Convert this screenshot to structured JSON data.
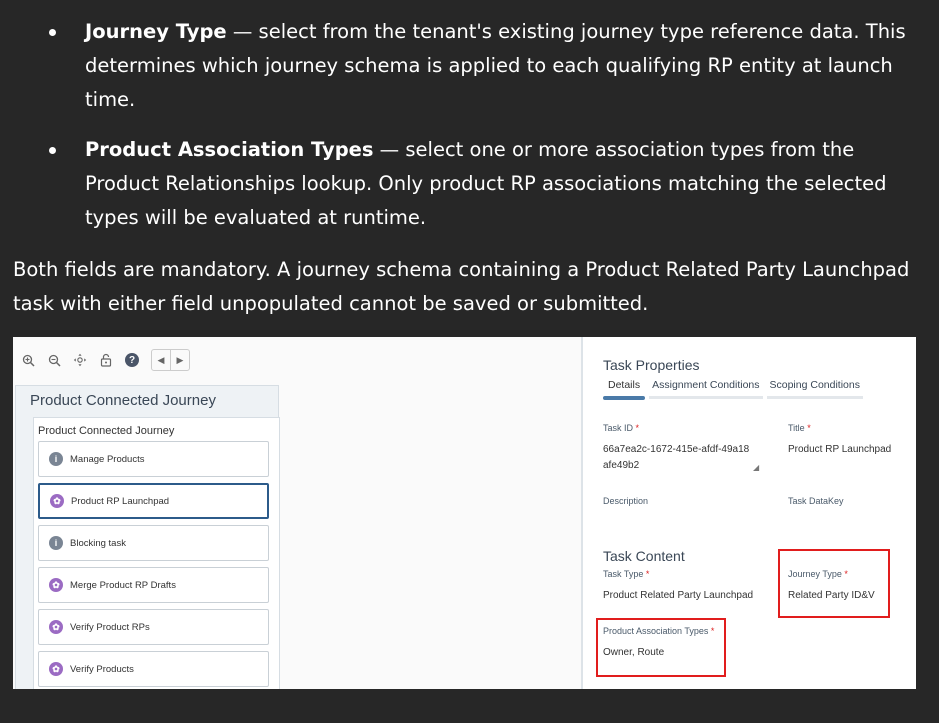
{
  "bullets": [
    {
      "term": "Journey Type",
      "text": " — select from the tenant's existing journey type reference data. This determines which journey schema is applied to each qualifying RP entity at launch time."
    },
    {
      "term": "Product Association Types",
      "text": " — select one or more association types from the Product Relationships lookup. Only product RP associations matching the selected types will be evaluated at runtime."
    }
  ],
  "paragraph": "Both fields are mandatory. A journey schema containing a Product Related Party Launchpad task with either field unpopulated cannot be saved or submitted.",
  "screenshot": {
    "toolbar": {
      "icons": [
        "zoom-in-icon",
        "zoom-out-icon",
        "move-icon",
        "lock-icon",
        "help-icon"
      ],
      "help_glyph": "?",
      "nav_prev": "◀",
      "nav_next": "▶"
    },
    "journey": {
      "title": "Product Connected Journey",
      "inner_title": "Product Connected Journey",
      "tasks": [
        {
          "label": "Manage Products",
          "icon": "info"
        },
        {
          "label": "Product RP Launchpad",
          "icon": "gear",
          "selected": true
        },
        {
          "label": "Blocking task",
          "icon": "info"
        },
        {
          "label": "Merge Product RP Drafts",
          "icon": "gear"
        },
        {
          "label": "Verify Product RPs",
          "icon": "gear"
        },
        {
          "label": "Verify Products",
          "icon": "gear"
        }
      ]
    },
    "properties": {
      "title": "Task Properties",
      "tabs": [
        "Details",
        "Assignment Conditions",
        "Scoping Conditions"
      ],
      "active_tab": "Details",
      "task_id_label": "Task ID",
      "task_id_value": "66a7ea2c-1672-415e-afdf-49a18afe49b2",
      "title_label": "Title",
      "title_value": "Product RP Launchpad",
      "description_label": "Description",
      "datakey_label": "Task DataKey",
      "content_title": "Task Content",
      "task_type_label": "Task Type",
      "task_type_value": "Product Related Party Launchpad",
      "journey_type_label": "Journey Type",
      "journey_type_value": "Related Party ID&V",
      "assoc_label": "Product Association Types",
      "assoc_value": "Owner, Route",
      "required_mark": "*"
    }
  },
  "colors": {
    "page_bg": "#272727",
    "highlight": "#e11d1d",
    "tab_active": "#4a7aa8",
    "gear_icon": "#9b6bc3",
    "info_icon": "#7a8594"
  }
}
